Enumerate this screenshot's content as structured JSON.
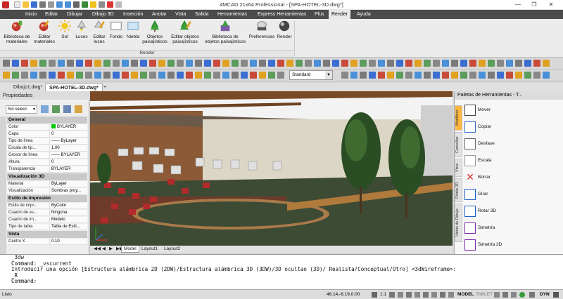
{
  "app": {
    "title": "4MCAD 21x64 Professional - [SPA-HOTEL-3D.dwg*]",
    "window_controls": [
      "—",
      "❐",
      "✕"
    ]
  },
  "menu": [
    "Inicio",
    "Editar",
    "Dibujar",
    "Dibujo 3D",
    "Inserción",
    "Anotar",
    "Vista",
    "Salida",
    "Herramientas",
    "Express Herramientas",
    "Plus",
    "Render",
    "Ayuda"
  ],
  "menu_active": "Render",
  "ribbon": {
    "buttons": [
      {
        "label": "Biblioteca de\nmateriales",
        "icon": "materials-library-icon"
      },
      {
        "label": "Editar\nmateriales",
        "icon": "edit-materials-icon"
      },
      {
        "label": "Sol",
        "icon": "sun-icon"
      },
      {
        "label": "Luces",
        "icon": "lights-icon"
      },
      {
        "label": "Editar\nluces",
        "icon": "edit-lights-icon"
      },
      {
        "label": "Fondo",
        "icon": "background-icon"
      },
      {
        "label": "Niebla",
        "icon": "fog-icon"
      },
      {
        "label": "Objetos\npaisajísticos",
        "icon": "landscape-objects-icon"
      },
      {
        "label": "Editar objetos\npaisajísticos",
        "icon": "edit-landscape-icon"
      },
      {
        "label": "Biblioteca de\nobjetos paisajísticos",
        "icon": "landscape-library-icon"
      },
      {
        "label": "Preferencias",
        "icon": "preferences-icon"
      },
      {
        "label": "Render",
        "icon": "render-icon"
      }
    ],
    "group_label": "Render"
  },
  "toolbar": {
    "text_style": "Standard"
  },
  "doc_tabs": [
    "Dibujo1.dwg*",
    "SPA-HOTEL-3D.dwg*",
    "+"
  ],
  "properties": {
    "title": "Propiedades",
    "selection": "Sin selecc",
    "sections": [
      {
        "name": "General",
        "rows": [
          {
            "k": "Color",
            "v": "BYLAYER"
          },
          {
            "k": "Capa",
            "v": "0"
          },
          {
            "k": "Tipo de línea",
            "v": "—— ByLayer"
          },
          {
            "k": "Escala de tip...",
            "v": "1.00"
          },
          {
            "k": "Grosor de línea",
            "v": "—— BYLAYER"
          },
          {
            "k": "Altura",
            "v": "0"
          },
          {
            "k": "Transparencia",
            "v": "BYLAYER"
          }
        ]
      },
      {
        "name": "Visualización 3D",
        "rows": [
          {
            "k": "Material",
            "v": "ByLayer"
          },
          {
            "k": "Visualización",
            "v": "Sombras proy..."
          }
        ]
      },
      {
        "name": "Estilo de Impresión",
        "rows": [
          {
            "k": "Estilo de impr...",
            "v": "ByColor"
          },
          {
            "k": "Cuadro de es...",
            "v": "Ninguna"
          },
          {
            "k": "Cuadro de im...",
            "v": "Modelo"
          },
          {
            "k": "Tipo de tabla",
            "v": "Tabla de Estil..."
          }
        ]
      },
      {
        "name": "Vista",
        "rows": [
          {
            "k": "Centro X",
            "v": "0.10"
          }
        ]
      }
    ],
    "side_label": "Propiedades"
  },
  "layout_tabs": [
    "Model",
    "Layout1",
    "Layout2"
  ],
  "palette": {
    "title": "Paletas de Herramientas - T...",
    "vtabs": [
      "Modificar",
      "Consultar",
      "Vista",
      "Órbita 3D",
      "Vistas de Dibujo"
    ],
    "tools": [
      {
        "label": "Mover",
        "icon": "move-icon"
      },
      {
        "label": "Copiar",
        "icon": "copy-icon"
      },
      {
        "label": "Desfase",
        "icon": "offset-icon"
      },
      {
        "label": "Escala",
        "icon": "scale-icon"
      },
      {
        "label": "Borrar",
        "icon": "erase-icon"
      },
      {
        "label": "Girar",
        "icon": "rotate-icon"
      },
      {
        "label": "Rotar 3D",
        "icon": "rotate-3d-icon"
      },
      {
        "label": "Simetría",
        "icon": "mirror-icon"
      },
      {
        "label": "Simetría 3D",
        "icon": "mirror-3d-icon"
      }
    ]
  },
  "command_lines": [
    "_3dw",
    "Command: _vscurrent",
    "Introducir una opción [Estructura alámbrica 2D (2DW)/Estructura alámbrica 3D (3DW)/3D ocultao (3D)/ Realista/Conceptual/Otro] <3dWireframe>:",
    "_R",
    "Command:"
  ],
  "status": {
    "left": "Listo",
    "coords": "46.14,-6.19,0.00",
    "scale": "1:1",
    "model": "MODEL",
    "tablet": "TABLET",
    "dyn": "DYN"
  },
  "colors": {
    "menubar": "#4b4b4b",
    "accent_tab": "#ffb63d",
    "color_swatch": "#00c800"
  }
}
